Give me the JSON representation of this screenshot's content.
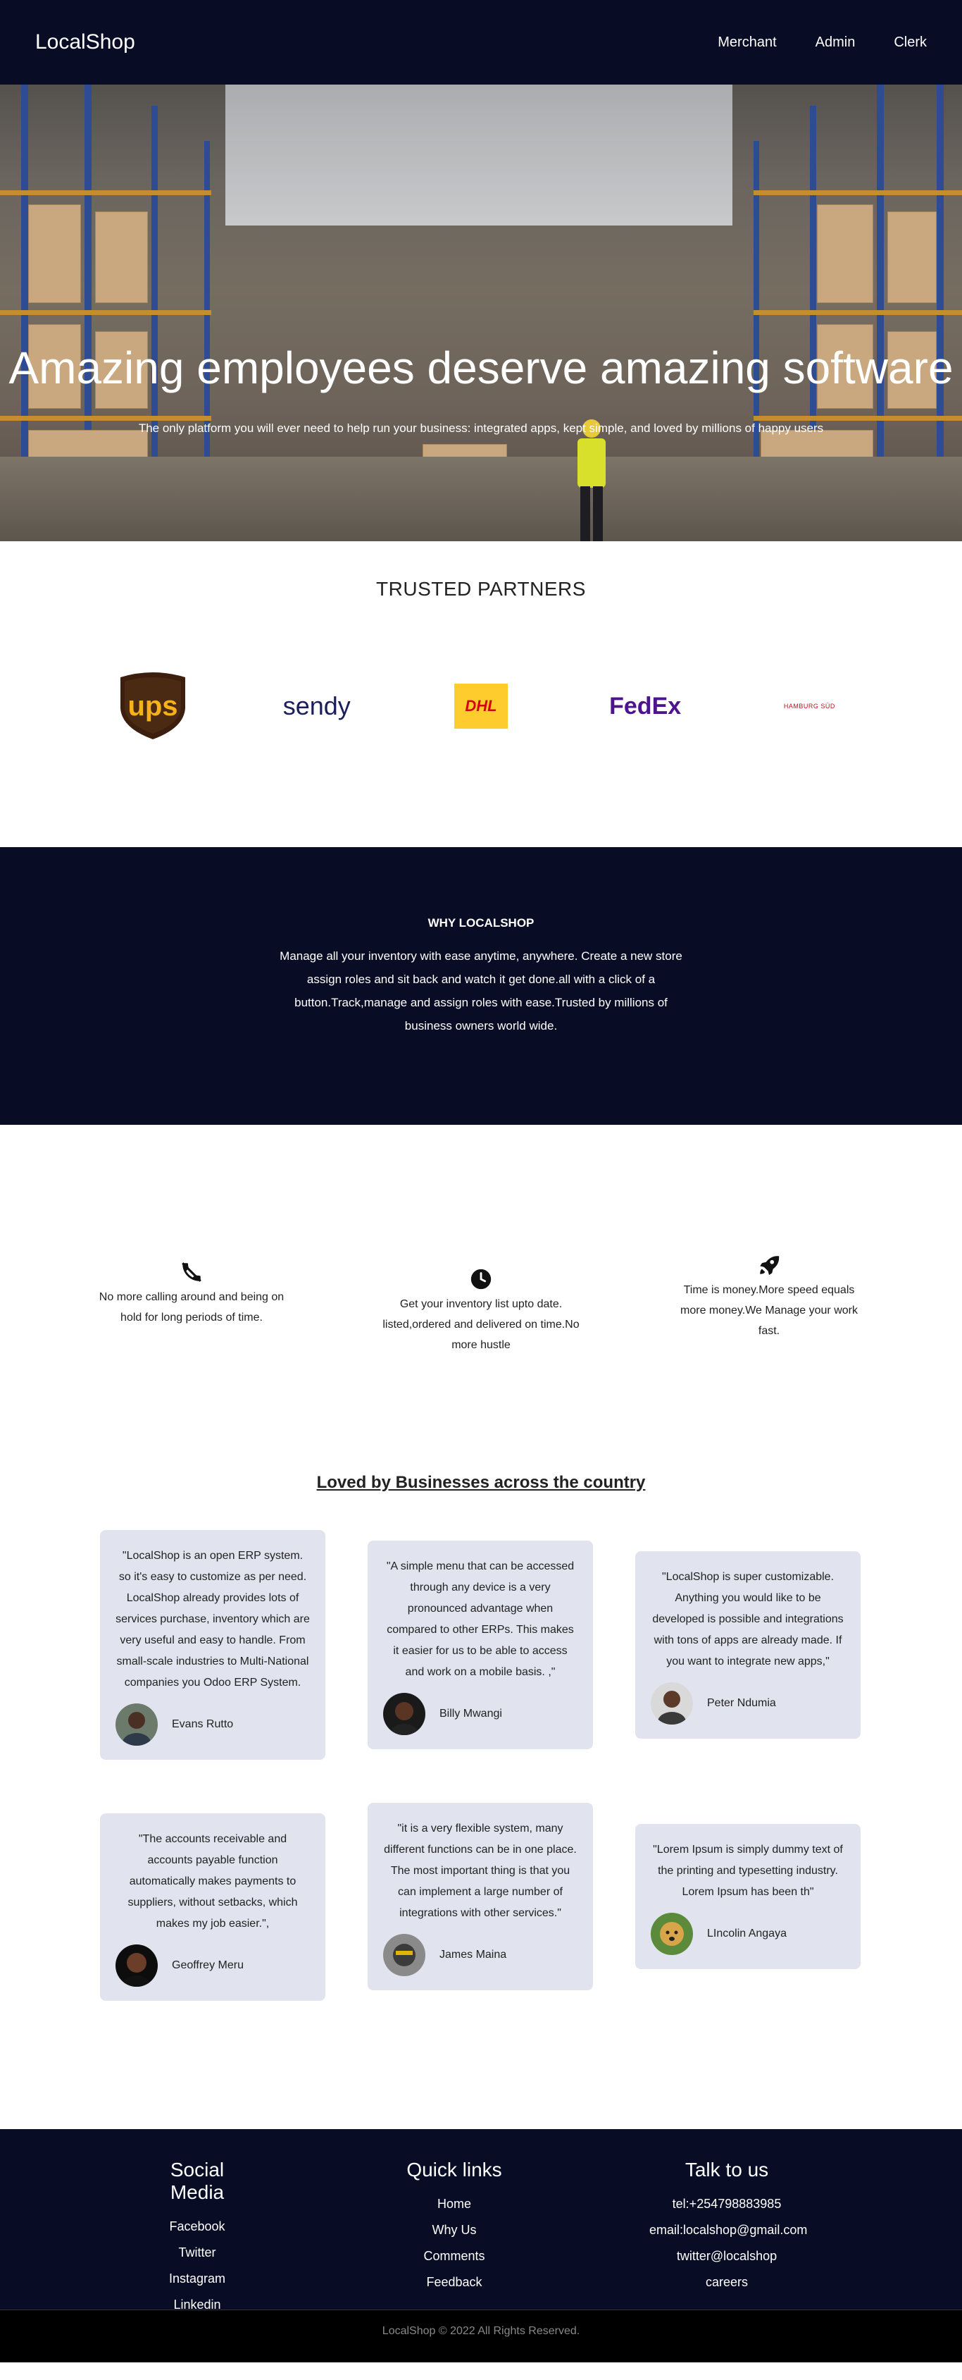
{
  "nav": {
    "brand": "LocalShop",
    "links": [
      "Merchant",
      "Admin",
      "Clerk"
    ]
  },
  "hero": {
    "title": "Amazing employees deserve amazing software",
    "subtitle": "The only platform you will ever need to help run your business: integrated apps, kept simple, and loved by millions of happy users"
  },
  "partners": {
    "heading": "TRUSTED PARTNERS",
    "logos": [
      {
        "name": "ups",
        "label": "ups",
        "color": "#f6b21a"
      },
      {
        "name": "sendy",
        "label": "sendy",
        "color": "#1a1f5a"
      },
      {
        "name": "dhl",
        "label": "DHL",
        "color": "#d40511"
      },
      {
        "name": "fedex",
        "label": "FedEx",
        "color": "#4d148c"
      },
      {
        "name": "hamburg-sud",
        "label": "HAMBURG SÜD",
        "color": "#b0161c"
      }
    ]
  },
  "why": {
    "heading": "WHY LOCALSHOP",
    "body": "Manage all your inventory with ease anytime, anywhere. Create a new store assign roles and sit back and watch it get done.all with a click of a button.Track,manage and assign roles with ease.Trusted by millions of business owners world wide."
  },
  "features": [
    {
      "icon": "no-phone-icon",
      "text": "No more calling around and being on hold for long periods of time."
    },
    {
      "icon": "clock-icon",
      "text": "Get your inventory list upto date. listed,ordered and delivered on time.No more hustle"
    },
    {
      "icon": "rocket-icon",
      "text": "Time is money.More speed equals more money.We Manage your work fast."
    }
  ],
  "testimonials": {
    "heading": "Loved by Businesses across the country",
    "cards": [
      {
        "quote": "\"LocalShop is an open ERP system. so it's easy to customize as per need. LocalShop already provides lots of services purchase, inventory which are very useful and easy to handle. From small-scale industries to Multi-National companies you Odoo ERP System.",
        "author": "Evans Rutto"
      },
      {
        "quote": "\"A simple menu that can be accessed through any device is a very pronounced advantage when compared to other ERPs. This makes it easier for us to be able to access and work on a mobile basis. ,\"",
        "author": "Billy Mwangi"
      },
      {
        "quote": "\"LocalShop is super customizable. Anything you would like to be developed is possible and integrations with tons of apps are already made. If you want to integrate new apps,\"",
        "author": "Peter Ndumia"
      },
      {
        "quote": "\"The accounts receivable and accounts payable function automatically makes payments to suppliers, without setbacks, which makes my job easier.\",",
        "author": "Geoffrey Meru"
      },
      {
        "quote": "\"it is a very flexible system, many different functions can be in one place. The most important thing is that you can implement a large number of integrations with other services.\"",
        "author": "James Maina"
      },
      {
        "quote": "\"Lorem Ipsum is simply dummy text of the printing and typesetting industry. Lorem Ipsum has been th\"",
        "author": "LIncolin Angaya"
      }
    ]
  },
  "footer": {
    "social": {
      "heading": "Social Media",
      "links": [
        "Facebook",
        "Twitter",
        "Instagram",
        "Linkedin"
      ]
    },
    "quick": {
      "heading": "Quick links",
      "links": [
        "Home",
        "Why Us",
        "Comments",
        "Feedback"
      ]
    },
    "talk": {
      "heading": "Talk to us",
      "links": [
        "tel:+254798883985",
        "email:localshop@gmail.com",
        "twitter@localshop",
        "careers"
      ]
    },
    "copyright": "LocalShop © 2022 All Rights Reserved."
  }
}
